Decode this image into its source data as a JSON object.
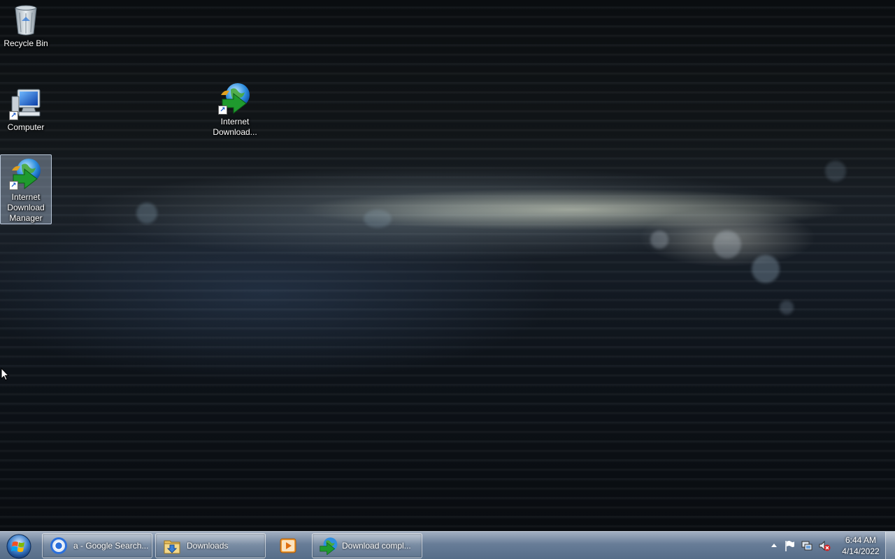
{
  "desktop": {
    "icons": [
      {
        "label": "Recycle Bin",
        "icon": "recycle-bin-icon",
        "selected": false
      },
      {
        "label": "Computer",
        "icon": "computer-icon",
        "selected": false
      },
      {
        "label": "Internet Download...",
        "icon": "idm-icon",
        "selected": false
      },
      {
        "label": "Internet Download Manager",
        "icon": "idm-icon",
        "selected": true
      }
    ]
  },
  "taskbar": {
    "start_icon": "windows-start-orb-icon",
    "buttons": [
      {
        "label": "a - Google Search...",
        "icon": "chrome-icon"
      },
      {
        "label": "Downloads",
        "icon": "folder-downloads-icon"
      },
      {
        "label": "",
        "icon": "media-player-icon"
      },
      {
        "label": "Download compl...",
        "icon": "idm-icon"
      }
    ],
    "tray": {
      "icons": [
        "show-hidden-icons-chevron",
        "action-center-flag-icon",
        "network-icon",
        "volume-muted-icon"
      ]
    },
    "clock": {
      "time": "6:44 AM",
      "date": "4/14/2022"
    }
  },
  "colors": {
    "taskbar": "#7f97b5",
    "selection": "#c8dcf5"
  }
}
